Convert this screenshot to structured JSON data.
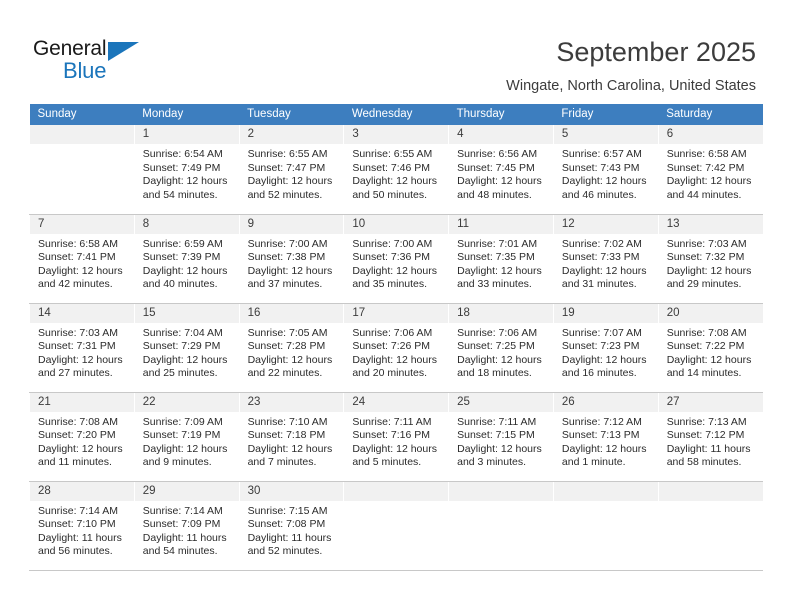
{
  "logo": {
    "word1": "General",
    "word2": "Blue",
    "triangle_color": "#1b75bb",
    "icon": "triangle-icon"
  },
  "header": {
    "title": "September 2025",
    "subtitle": "Wingate, North Carolina, United States"
  },
  "calendar": {
    "header_bg": "#3d7ebf",
    "daynum_bg": "#f1f1f1",
    "weekday_headers": [
      "Sunday",
      "Monday",
      "Tuesday",
      "Wednesday",
      "Thursday",
      "Friday",
      "Saturday"
    ],
    "labels": {
      "sunrise": "Sunrise:",
      "sunset": "Sunset:",
      "daylight": "Daylight:"
    },
    "weeks": [
      [
        {
          "day": "",
          "blank": true
        },
        {
          "day": "1",
          "sunrise": "Sunrise: 6:54 AM",
          "sunset": "Sunset: 7:49 PM",
          "daylight_1": "Daylight: 12 hours",
          "daylight_2": "and 54 minutes."
        },
        {
          "day": "2",
          "sunrise": "Sunrise: 6:55 AM",
          "sunset": "Sunset: 7:47 PM",
          "daylight_1": "Daylight: 12 hours",
          "daylight_2": "and 52 minutes."
        },
        {
          "day": "3",
          "sunrise": "Sunrise: 6:55 AM",
          "sunset": "Sunset: 7:46 PM",
          "daylight_1": "Daylight: 12 hours",
          "daylight_2": "and 50 minutes."
        },
        {
          "day": "4",
          "sunrise": "Sunrise: 6:56 AM",
          "sunset": "Sunset: 7:45 PM",
          "daylight_1": "Daylight: 12 hours",
          "daylight_2": "and 48 minutes."
        },
        {
          "day": "5",
          "sunrise": "Sunrise: 6:57 AM",
          "sunset": "Sunset: 7:43 PM",
          "daylight_1": "Daylight: 12 hours",
          "daylight_2": "and 46 minutes."
        },
        {
          "day": "6",
          "sunrise": "Sunrise: 6:58 AM",
          "sunset": "Sunset: 7:42 PM",
          "daylight_1": "Daylight: 12 hours",
          "daylight_2": "and 44 minutes."
        }
      ],
      [
        {
          "day": "7",
          "sunrise": "Sunrise: 6:58 AM",
          "sunset": "Sunset: 7:41 PM",
          "daylight_1": "Daylight: 12 hours",
          "daylight_2": "and 42 minutes."
        },
        {
          "day": "8",
          "sunrise": "Sunrise: 6:59 AM",
          "sunset": "Sunset: 7:39 PM",
          "daylight_1": "Daylight: 12 hours",
          "daylight_2": "and 40 minutes."
        },
        {
          "day": "9",
          "sunrise": "Sunrise: 7:00 AM",
          "sunset": "Sunset: 7:38 PM",
          "daylight_1": "Daylight: 12 hours",
          "daylight_2": "and 37 minutes."
        },
        {
          "day": "10",
          "sunrise": "Sunrise: 7:00 AM",
          "sunset": "Sunset: 7:36 PM",
          "daylight_1": "Daylight: 12 hours",
          "daylight_2": "and 35 minutes."
        },
        {
          "day": "11",
          "sunrise": "Sunrise: 7:01 AM",
          "sunset": "Sunset: 7:35 PM",
          "daylight_1": "Daylight: 12 hours",
          "daylight_2": "and 33 minutes."
        },
        {
          "day": "12",
          "sunrise": "Sunrise: 7:02 AM",
          "sunset": "Sunset: 7:33 PM",
          "daylight_1": "Daylight: 12 hours",
          "daylight_2": "and 31 minutes."
        },
        {
          "day": "13",
          "sunrise": "Sunrise: 7:03 AM",
          "sunset": "Sunset: 7:32 PM",
          "daylight_1": "Daylight: 12 hours",
          "daylight_2": "and 29 minutes."
        }
      ],
      [
        {
          "day": "14",
          "sunrise": "Sunrise: 7:03 AM",
          "sunset": "Sunset: 7:31 PM",
          "daylight_1": "Daylight: 12 hours",
          "daylight_2": "and 27 minutes."
        },
        {
          "day": "15",
          "sunrise": "Sunrise: 7:04 AM",
          "sunset": "Sunset: 7:29 PM",
          "daylight_1": "Daylight: 12 hours",
          "daylight_2": "and 25 minutes."
        },
        {
          "day": "16",
          "sunrise": "Sunrise: 7:05 AM",
          "sunset": "Sunset: 7:28 PM",
          "daylight_1": "Daylight: 12 hours",
          "daylight_2": "and 22 minutes."
        },
        {
          "day": "17",
          "sunrise": "Sunrise: 7:06 AM",
          "sunset": "Sunset: 7:26 PM",
          "daylight_1": "Daylight: 12 hours",
          "daylight_2": "and 20 minutes."
        },
        {
          "day": "18",
          "sunrise": "Sunrise: 7:06 AM",
          "sunset": "Sunset: 7:25 PM",
          "daylight_1": "Daylight: 12 hours",
          "daylight_2": "and 18 minutes."
        },
        {
          "day": "19",
          "sunrise": "Sunrise: 7:07 AM",
          "sunset": "Sunset: 7:23 PM",
          "daylight_1": "Daylight: 12 hours",
          "daylight_2": "and 16 minutes."
        },
        {
          "day": "20",
          "sunrise": "Sunrise: 7:08 AM",
          "sunset": "Sunset: 7:22 PM",
          "daylight_1": "Daylight: 12 hours",
          "daylight_2": "and 14 minutes."
        }
      ],
      [
        {
          "day": "21",
          "sunrise": "Sunrise: 7:08 AM",
          "sunset": "Sunset: 7:20 PM",
          "daylight_1": "Daylight: 12 hours",
          "daylight_2": "and 11 minutes."
        },
        {
          "day": "22",
          "sunrise": "Sunrise: 7:09 AM",
          "sunset": "Sunset: 7:19 PM",
          "daylight_1": "Daylight: 12 hours",
          "daylight_2": "and 9 minutes."
        },
        {
          "day": "23",
          "sunrise": "Sunrise: 7:10 AM",
          "sunset": "Sunset: 7:18 PM",
          "daylight_1": "Daylight: 12 hours",
          "daylight_2": "and 7 minutes."
        },
        {
          "day": "24",
          "sunrise": "Sunrise: 7:11 AM",
          "sunset": "Sunset: 7:16 PM",
          "daylight_1": "Daylight: 12 hours",
          "daylight_2": "and 5 minutes."
        },
        {
          "day": "25",
          "sunrise": "Sunrise: 7:11 AM",
          "sunset": "Sunset: 7:15 PM",
          "daylight_1": "Daylight: 12 hours",
          "daylight_2": "and 3 minutes."
        },
        {
          "day": "26",
          "sunrise": "Sunrise: 7:12 AM",
          "sunset": "Sunset: 7:13 PM",
          "daylight_1": "Daylight: 12 hours",
          "daylight_2": "and 1 minute."
        },
        {
          "day": "27",
          "sunrise": "Sunrise: 7:13 AM",
          "sunset": "Sunset: 7:12 PM",
          "daylight_1": "Daylight: 11 hours",
          "daylight_2": "and 58 minutes."
        }
      ],
      [
        {
          "day": "28",
          "sunrise": "Sunrise: 7:14 AM",
          "sunset": "Sunset: 7:10 PM",
          "daylight_1": "Daylight: 11 hours",
          "daylight_2": "and 56 minutes."
        },
        {
          "day": "29",
          "sunrise": "Sunrise: 7:14 AM",
          "sunset": "Sunset: 7:09 PM",
          "daylight_1": "Daylight: 11 hours",
          "daylight_2": "and 54 minutes."
        },
        {
          "day": "30",
          "sunrise": "Sunrise: 7:15 AM",
          "sunset": "Sunset: 7:08 PM",
          "daylight_1": "Daylight: 11 hours",
          "daylight_2": "and 52 minutes."
        },
        {
          "day": "",
          "blank": true
        },
        {
          "day": "",
          "blank": true
        },
        {
          "day": "",
          "blank": true
        },
        {
          "day": "",
          "blank": true
        }
      ]
    ]
  }
}
